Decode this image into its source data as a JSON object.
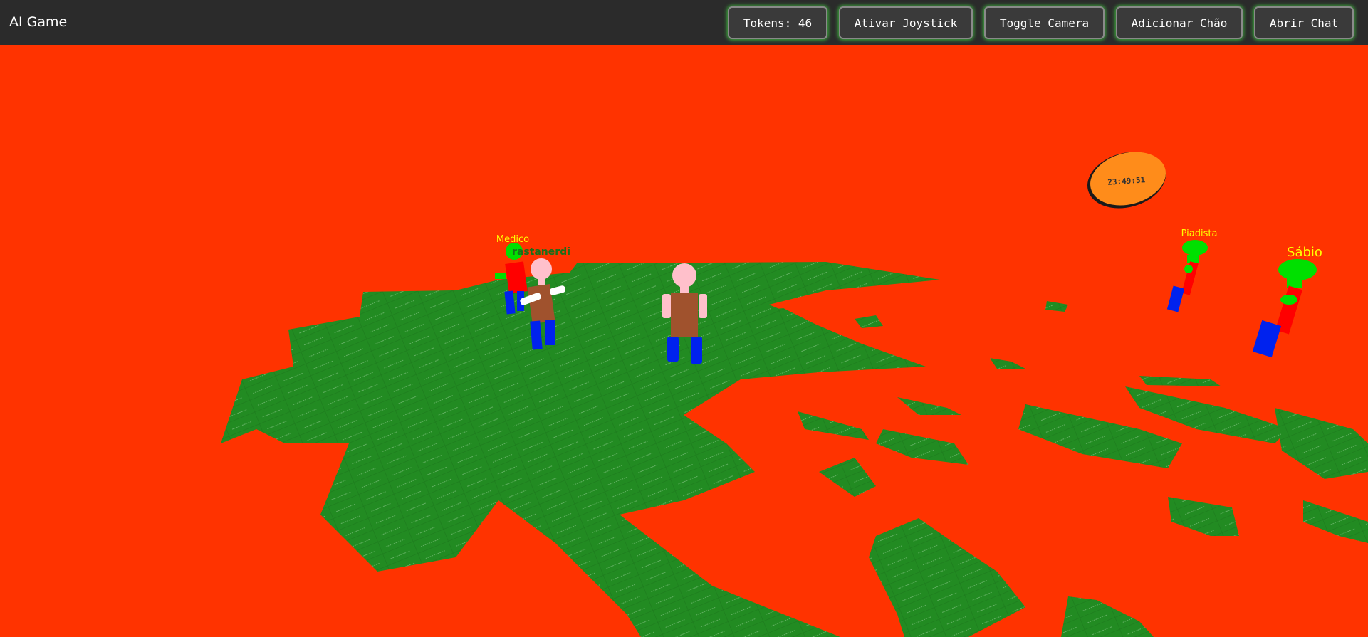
{
  "header": {
    "app_title": "AI Game",
    "buttons": {
      "tokens": "Tokens: 46",
      "joystick": "Ativar Joystick",
      "camera": "Toggle Camera",
      "floor": "Adicionar Chão",
      "chat": "Abrir Chat"
    }
  },
  "scene": {
    "sky_color": "#ff3300",
    "ground_color": "#228b22",
    "tile_watermark": "santocyber",
    "clock_text": "23:49:51",
    "labels": {
      "medico": "Medico",
      "player": "rastanerdi",
      "piadista": "Piadista",
      "sabio": "Sábio"
    }
  },
  "colors": {
    "button_glow": "#3fbf3f",
    "npc_label": "#ffff00",
    "player_label": "#1a6e1a"
  }
}
